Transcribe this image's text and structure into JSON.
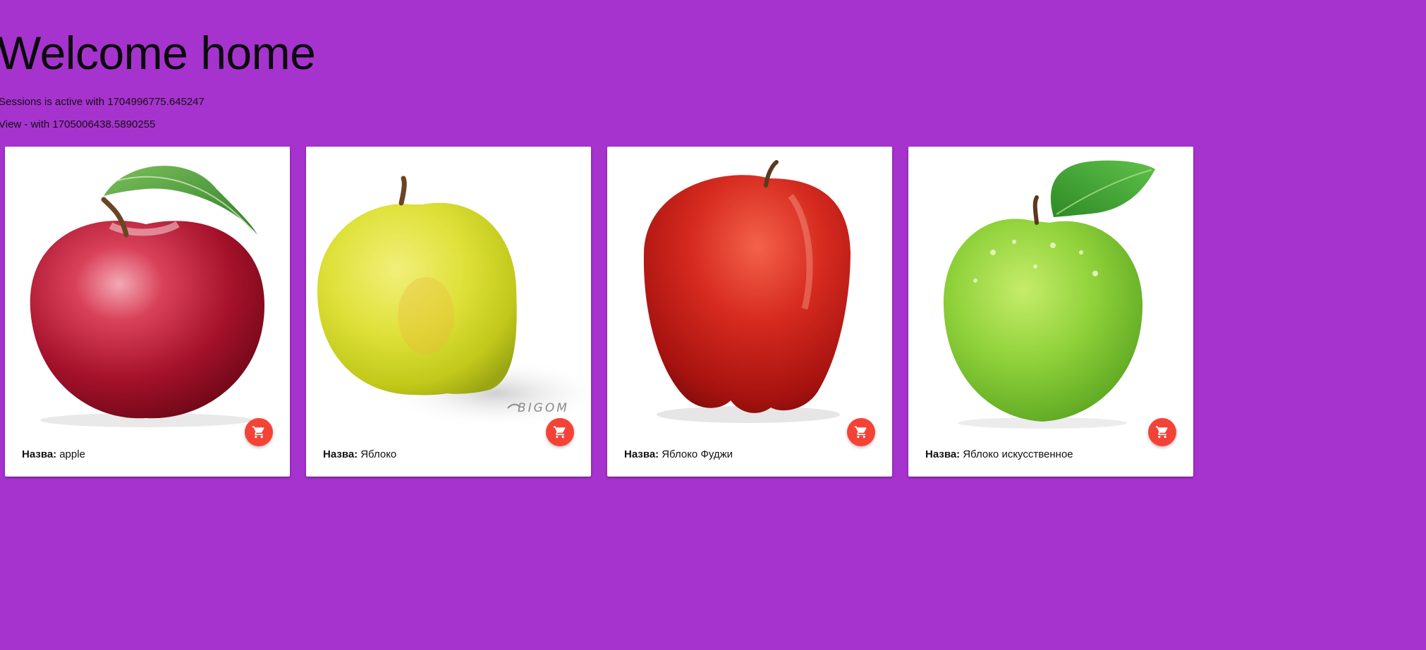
{
  "header": {
    "title": "Welcome home",
    "session_line": "Sessions is active with 1704996775.645247",
    "view_line": "View - with 1705006438.5890255"
  },
  "products": [
    {
      "label": "Назва:",
      "name": "apple",
      "image": "red-apple-with-leaf",
      "cart_icon": "cart-icon"
    },
    {
      "label": "Назва:",
      "name": "Яблоко",
      "image": "yellow-green-apple",
      "cart_icon": "cart-icon",
      "watermark": "BIGOM"
    },
    {
      "label": "Назва:",
      "name": "Яблоко Фуджи",
      "image": "fuji-red-apple",
      "cart_icon": "cart-icon"
    },
    {
      "label": "Назва:",
      "name": "Яблоко искусственное",
      "image": "green-apple-with-leaf",
      "cart_icon": "cart-icon"
    }
  ],
  "colors": {
    "background": "#a733cf",
    "card": "#ffffff",
    "cart_button": "#f44336"
  }
}
